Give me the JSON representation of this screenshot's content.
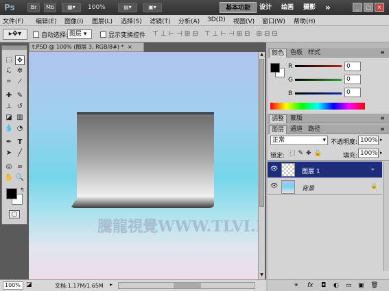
{
  "titlebar": {
    "app": "Ps",
    "br": "Br",
    "mb": "Mb",
    "zoom": "100%",
    "workspaces": [
      "基本功能",
      "设计",
      "绘画",
      "摄影"
    ],
    "more": "»"
  },
  "menu": [
    "文件(F)",
    "编辑(E)",
    "图像(I)",
    "图层(L)",
    "选择(S)",
    "滤镜(T)",
    "分析(A)",
    "3D(D)",
    "视图(V)",
    "窗口(W)",
    "帮助(H)"
  ],
  "options": {
    "auto_select": "自动选择:",
    "auto_select_value": "图层",
    "show_transform": "显示变换控件"
  },
  "document": {
    "tab_title": "t.PSD @ 100% (图层 3, RGB/8#) *",
    "watermark": "騰龍視覺WWW.TLVI.NET",
    "zoom": "100%",
    "doc_info": "文档:1.17M/1.65M"
  },
  "color_panel": {
    "tabs": [
      "颜色",
      "色板",
      "样式"
    ],
    "channels": [
      {
        "label": "R",
        "value": "0",
        "color": "#e01010"
      },
      {
        "label": "G",
        "value": "0",
        "color": "#10b010"
      },
      {
        "label": "B",
        "value": "0",
        "color": "#1020e0"
      }
    ]
  },
  "adjust_panel": {
    "tabs": [
      "调整",
      "蒙版"
    ]
  },
  "layers_panel": {
    "tabs": [
      "图层",
      "通道",
      "路径"
    ],
    "blend_mode": "正常",
    "opacity_label": "不透明度:",
    "opacity": "100%",
    "lock_label": "锁定:",
    "fill_label": "填充:",
    "fill": "100%",
    "layers": [
      {
        "name": "图层 1",
        "selected": true
      },
      {
        "name": "背景",
        "selected": false
      }
    ]
  }
}
